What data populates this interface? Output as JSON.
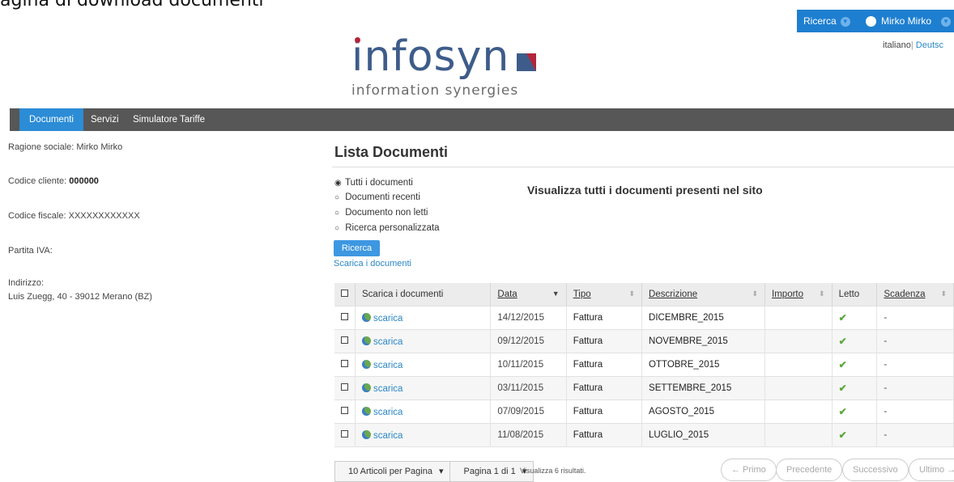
{
  "page": {
    "caption": "agina di download documenti"
  },
  "topbar": {
    "search_label": "Ricerca",
    "user_name": "Mirko Mirko",
    "languages": [
      "italiano",
      "Deutsc"
    ]
  },
  "logo": {
    "name": "infosyn",
    "tagline": "information synergies"
  },
  "nav": {
    "tabs": [
      "Documenti",
      "Servizi",
      "Simulatore Tariffe"
    ],
    "active": "Documenti"
  },
  "customer": {
    "ragione_label": "Ragione sociale:",
    "ragione_value": "Mirko Mirko",
    "codice_cliente_label": "Codice cliente:",
    "codice_cliente_value": "000000",
    "codice_fiscale_label": "Codice fiscale:",
    "codice_fiscale_value": "XXXXXXXXXXXX",
    "partita_iva_label": "Partita IVA:",
    "indirizzo_label": "Indirizzo:",
    "indirizzo_value": "Luis Zuegg, 40 - 39012 Merano (BZ)"
  },
  "main": {
    "title": "Lista Documenti",
    "headline": "Visualizza tutti i documenti presenti nel sito",
    "filters": [
      "Tutti i documenti",
      "Documenti recenti",
      "Documento non letti",
      "Ricerca personalizzata"
    ],
    "selected_filter": "Tutti i documenti",
    "search_button": "Ricerca",
    "download_link": "Scarica i documenti"
  },
  "table": {
    "columns": [
      "Scarica i documenti",
      "Data",
      "Tipo",
      "Descrizione",
      "Importo",
      "Letto",
      "Scadenza"
    ],
    "rows": [
      {
        "link": "scarica",
        "data": "14/12/2015",
        "tipo": "Fattura",
        "descrizione": "DICEMBRE_2015",
        "importo": "",
        "letto": "✔",
        "scadenza": "-"
      },
      {
        "link": "scarica",
        "data": "09/12/2015",
        "tipo": "Fattura",
        "descrizione": "NOVEMBRE_2015",
        "importo": "",
        "letto": "✔",
        "scadenza": "-"
      },
      {
        "link": "scarica",
        "data": "10/11/2015",
        "tipo": "Fattura",
        "descrizione": "OTTOBRE_2015",
        "importo": "",
        "letto": "✔",
        "scadenza": "-"
      },
      {
        "link": "scarica",
        "data": "03/11/2015",
        "tipo": "Fattura",
        "descrizione": "SETTEMBRE_2015",
        "importo": "",
        "letto": "✔",
        "scadenza": "-"
      },
      {
        "link": "scarica",
        "data": "07/09/2015",
        "tipo": "Fattura",
        "descrizione": "AGOSTO_2015",
        "importo": "",
        "letto": "✔",
        "scadenza": "-"
      },
      {
        "link": "scarica",
        "data": "11/08/2015",
        "tipo": "Fattura",
        "descrizione": "LUGLIO_2015",
        "importo": "",
        "letto": "✔",
        "scadenza": "-"
      }
    ]
  },
  "pager": {
    "per_page": "10 Articoli per Pagina",
    "page": "Pagina 1 di 1",
    "results": "Visualizza 6 risultati.",
    "first": "← Primo",
    "prev": "Precedente",
    "next": "Successivo",
    "last": "Ultimo →"
  }
}
